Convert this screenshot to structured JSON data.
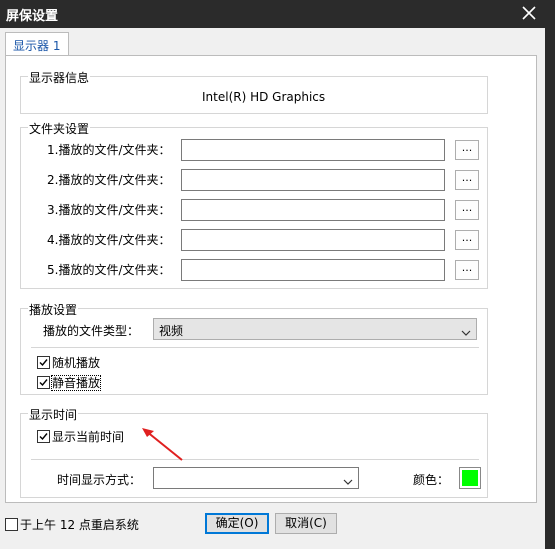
{
  "window": {
    "title": "屏保设置"
  },
  "tabs": [
    {
      "label": "显示器 1"
    }
  ],
  "display_info": {
    "legend": "显示器信息",
    "adapter": "Intel(R) HD Graphics"
  },
  "folders": {
    "legend": "文件夹设置",
    "rows": [
      {
        "label": "1.播放的文件/文件夹：",
        "value": "",
        "browse": "..."
      },
      {
        "label": "2.播放的文件/文件夹：",
        "value": "",
        "browse": "..."
      },
      {
        "label": "3.播放的文件/文件夹：",
        "value": "",
        "browse": "..."
      },
      {
        "label": "4.播放的文件/文件夹：",
        "value": "",
        "browse": "..."
      },
      {
        "label": "5.播放的文件/文件夹：",
        "value": "",
        "browse": "..."
      }
    ]
  },
  "playback": {
    "legend": "播放设置",
    "type_label": "播放的文件类型：",
    "type_value": "视频",
    "shuffle_label": "随机播放",
    "shuffle_checked": true,
    "mute_label": "静音播放",
    "mute_checked": true
  },
  "time": {
    "legend": "显示时间",
    "show_current_label": "显示当前时间",
    "show_current_checked": true,
    "format_label": "时间显示方式：",
    "format_value": "",
    "color_label": "颜色：",
    "color_value": "#00ff00"
  },
  "footer": {
    "restart_label": "于上午 12 点重启系统",
    "restart_checked": false,
    "ok_label": "确定(O)",
    "cancel_label": "取消(C)"
  }
}
